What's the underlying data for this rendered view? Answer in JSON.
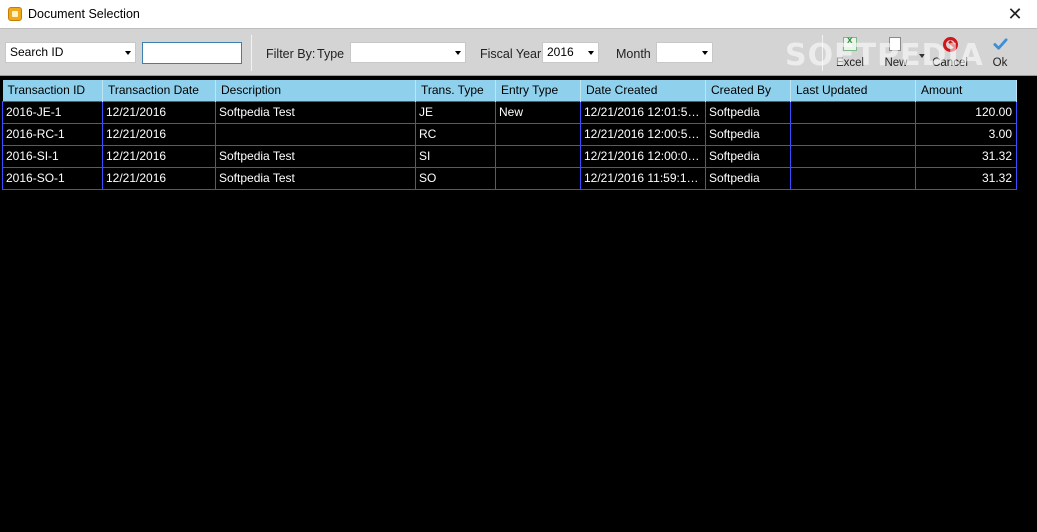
{
  "window": {
    "title": "Document Selection",
    "close_glyph": "✕"
  },
  "toolbar": {
    "search_field_select": "Search ID",
    "search_input_value": "",
    "filter_by_label": "Filter By:",
    "type_label": "Type",
    "type_value": "",
    "fiscal_year_label": "Fiscal Year",
    "fiscal_year_value": "2016",
    "month_label": "Month",
    "month_value": "",
    "excel_label": "Excel",
    "new_label": "New",
    "cancel_label": "Cancel",
    "ok_label": "Ok"
  },
  "watermark": "SOFTPEDIA",
  "table": {
    "columns": [
      "Transaction ID",
      "Transaction Date",
      "Description",
      "Trans. Type",
      "Entry Type",
      "Date Created",
      "Created By",
      "Last Updated",
      "Amount"
    ],
    "rows": [
      [
        "2016-JE-1",
        "12/21/2016",
        "Softpedia Test",
        "JE",
        "New",
        "12/21/2016 12:01:58 ...",
        "Softpedia",
        "",
        "120.00"
      ],
      [
        "2016-RC-1",
        "12/21/2016",
        "",
        "RC",
        "",
        "12/21/2016 12:00:54 ...",
        "Softpedia",
        "",
        "3.00"
      ],
      [
        "2016-SI-1",
        "12/21/2016",
        "Softpedia Test",
        "SI",
        "",
        "12/21/2016 12:00:07 ...",
        "Softpedia",
        "",
        "31.32"
      ],
      [
        "2016-SO-1",
        "12/21/2016",
        "Softpedia Test",
        "SO",
        "",
        "12/21/2016 11:59:16 ...",
        "Softpedia",
        "",
        "31.32"
      ]
    ]
  },
  "colors": {
    "header_bg": "#8fd1ec",
    "grid_border": "#3a4cff",
    "body_bg": "#000000",
    "toolbar_bg": "#d4d4d4"
  }
}
